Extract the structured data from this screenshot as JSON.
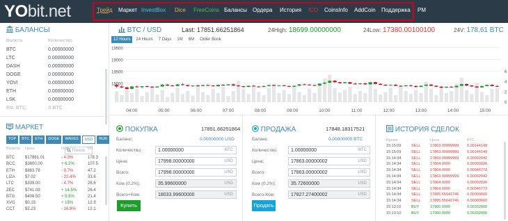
{
  "logo": {
    "main": "YO",
    "rest": "bit.net"
  },
  "nav": [
    {
      "label": "Трейд",
      "color": "#f0ad4e",
      "underline": true
    },
    {
      "label": "Маркет",
      "color": "#ffffff"
    },
    {
      "label": "InvestBox",
      "color": "#5bc0de"
    },
    {
      "label": "Dice",
      "color": "#f0ad4e"
    },
    {
      "label": "FreeCoins",
      "color": "#5cb85c"
    },
    {
      "label": "Балансы",
      "color": "#ffffff"
    },
    {
      "label": "Ордера",
      "color": "#ffffff"
    },
    {
      "label": "История",
      "color": "#ffffff"
    },
    {
      "label": "ICO",
      "color": "#e33333"
    },
    {
      "label": "CoinsInfo",
      "color": "#ffffff"
    },
    {
      "label": "AddCoin",
      "color": "#ffffff"
    },
    {
      "label": "Поддержка",
      "color": "#ffffff"
    },
    {
      "label": "PM",
      "color": "#ffffff"
    }
  ],
  "balances": {
    "title": "БАЛАНСЫ",
    "col_currency": "Валюта",
    "col_amount": "Количество",
    "rows": [
      {
        "cur": "BTC",
        "amt": "0.00000000"
      },
      {
        "cur": "LTC",
        "amt": "0.00000000"
      },
      {
        "cur": "DASH",
        "amt": "0.00000000"
      },
      {
        "cur": "DOGE",
        "amt": "0.00000000"
      },
      {
        "cur": "YOVI",
        "amt": "0.00000000"
      },
      {
        "cur": "ETH",
        "amt": "0.00000000"
      },
      {
        "cur": "LSK",
        "amt": "0.00000000"
      }
    ],
    "est_label": "Est. BTC:",
    "est_value": "X BTC"
  },
  "market": {
    "title": "МАРКЕТ",
    "search_placeholder": "Поиск",
    "tabs": [
      "TOP",
      "BTC",
      "ETH",
      "DOGE",
      "WAVES",
      "USD",
      "RUR"
    ],
    "active_tab": "USD",
    "col_currency": "Валюта",
    "col_price": "Цена",
    "col_change": "Изм.",
    "col_volume": "Об.",
    "rows": [
      {
        "cur": "BTC",
        "price": "$17861.01",
        "chg": "- 4.3%",
        "vol": "178.3",
        "up": false
      },
      {
        "cur": "BCC",
        "price": "$3600.00",
        "chg": "+ 6.2%",
        "vol": "107.5",
        "up": true
      },
      {
        "cur": "ETH",
        "price": "$883.78",
        "chg": "- 0.7%",
        "vol": "47.2",
        "up": false
      },
      {
        "cur": "LIZA",
        "price": "$7.02",
        "chg": "- 22.4%",
        "vol": "33.6",
        "up": false
      },
      {
        "cur": "LTC",
        "price": "$339.00",
        "chg": "- 4.7%",
        "vol": "26.6",
        "up": false
      },
      {
        "cur": "ZEC",
        "price": "$741.09",
        "chg": "+ 14.5%",
        "vol": "26.4",
        "up": true
      },
      {
        "cur": "BTG",
        "price": "$408.50",
        "chg": "+ 5.5%",
        "vol": "21.4",
        "up": true
      },
      {
        "cur": "XVG",
        "price": "$0.15",
        "chg": "+ 15%",
        "vol": "12.9",
        "up": true
      },
      {
        "cur": "CCT",
        "price": "$2.23",
        "chg": "- 16.9%",
        "vol": "12.1",
        "up": false
      }
    ]
  },
  "ticker": {
    "pair_base": "BTC",
    "pair_sep": " / ",
    "pair_quote": "USD",
    "last_label": "Last:",
    "last_value": "17851.66251864",
    "high_label": "24High:",
    "high_value": "18699.00000000",
    "low_label": "24Low:",
    "low_value": "17380.00100100",
    "vol_label": "24V:",
    "vol_value": "178.61 BTC"
  },
  "chart_tabs": [
    "12 Hours",
    "24 Hours",
    "7 Days",
    "1M",
    "6M",
    "Order Book"
  ],
  "chart_active_tab": "12 Hours",
  "chart_data": {
    "type": "candlestick",
    "ylim": [
      17200,
      19600
    ],
    "y_ticks": [
      19500,
      19000,
      18500,
      18000
    ],
    "volume_ylim": [
      0,
      6
    ],
    "volume_ticks": [
      6,
      4,
      2,
      0
    ],
    "x_ticks": [
      "04:00",
      "05:00",
      "06:00",
      "07:00",
      "08:00",
      "09:00",
      "10:00",
      "11:00",
      "12:00",
      "13:00",
      "14:00",
      "15:00"
    ],
    "candles": [
      [
        17920,
        17960,
        17800,
        17860
      ],
      [
        17860,
        17900,
        17780,
        17820
      ],
      [
        17820,
        17850,
        17740,
        17760
      ],
      [
        17760,
        17880,
        17740,
        17860
      ],
      [
        17860,
        17910,
        17800,
        17830
      ],
      [
        17830,
        17880,
        17790,
        17870
      ],
      [
        17870,
        17900,
        17830,
        17850
      ],
      [
        17850,
        17870,
        17800,
        17820
      ],
      [
        17820,
        17880,
        17810,
        17860
      ],
      [
        17860,
        17960,
        17850,
        17940
      ],
      [
        17940,
        17970,
        17880,
        17900
      ],
      [
        17900,
        17930,
        17860,
        17880
      ],
      [
        17880,
        17960,
        17870,
        17950
      ],
      [
        17950,
        18000,
        17900,
        17920
      ],
      [
        17920,
        17940,
        17860,
        17880
      ],
      [
        17880,
        17920,
        17840,
        17900
      ],
      [
        17900,
        17940,
        17870,
        17880
      ],
      [
        17880,
        17930,
        17870,
        17920
      ],
      [
        17920,
        17950,
        17880,
        17900
      ],
      [
        17900,
        17920,
        17850,
        17870
      ],
      [
        17870,
        17940,
        17860,
        17930
      ],
      [
        17930,
        17960,
        17890,
        17910
      ],
      [
        17910,
        17960,
        17900,
        17950
      ],
      [
        17950,
        17980,
        17890,
        17900
      ],
      [
        17900,
        17920,
        17850,
        17870
      ],
      [
        17870,
        17890,
        17820,
        17840
      ],
      [
        17840,
        17900,
        17830,
        17890
      ],
      [
        17890,
        17920,
        17850,
        17860
      ],
      [
        17860,
        17880,
        17820,
        17840
      ],
      [
        17840,
        17900,
        17830,
        17880
      ],
      [
        17880,
        17930,
        17870,
        17920
      ],
      [
        17920,
        17940,
        17880,
        17890
      ],
      [
        17890,
        17920,
        17860,
        17910
      ],
      [
        17910,
        17930,
        17870,
        17880
      ],
      [
        17880,
        17900,
        17840,
        17850
      ],
      [
        17850,
        17900,
        17840,
        17890
      ],
      [
        17890,
        17960,
        17880,
        17950
      ],
      [
        17950,
        17980,
        17920,
        17940
      ],
      [
        17940,
        17960,
        17900,
        17920
      ],
      [
        17920,
        17940,
        17880,
        17900
      ],
      [
        17900,
        17990,
        17890,
        17980
      ],
      [
        17980,
        18040,
        17960,
        18020
      ],
      [
        18020,
        18120,
        18000,
        18100
      ],
      [
        18100,
        18140,
        18020,
        18040
      ],
      [
        18040,
        18060,
        17980,
        18000
      ],
      [
        18000,
        18050,
        17990,
        18040
      ],
      [
        18040,
        18060,
        17960,
        17980
      ],
      [
        17980,
        18020,
        17940,
        17960
      ],
      [
        17960,
        18000,
        17930,
        17990
      ],
      [
        17990,
        18020,
        17940,
        17950
      ],
      [
        17950,
        18050,
        17940,
        18040
      ],
      [
        18040,
        18060,
        17950,
        17970
      ],
      [
        17970,
        18000,
        17920,
        17930
      ],
      [
        17930,
        17960,
        17880,
        17900
      ],
      [
        17900,
        17940,
        17890,
        17930
      ],
      [
        17930,
        17960,
        17880,
        17890
      ],
      [
        17890,
        17910,
        17850,
        17870
      ],
      [
        17870,
        17920,
        17860,
        17910
      ],
      [
        17910,
        17930,
        17860,
        17880
      ],
      [
        17880,
        17900,
        17820,
        17840
      ],
      [
        17840,
        17900,
        17830,
        17890
      ],
      [
        17890,
        17950,
        17880,
        17940
      ],
      [
        17940,
        17960,
        17880,
        17890
      ],
      [
        17890,
        17900,
        17830,
        17850
      ],
      [
        17850,
        17880,
        17790,
        17810
      ],
      [
        17810,
        17860,
        17800,
        17850
      ],
      [
        17850,
        17880,
        17820,
        17830
      ],
      [
        17830,
        17900,
        17820,
        17890
      ],
      [
        17890,
        17970,
        17880,
        17960
      ],
      [
        17960,
        17980,
        17880,
        17900
      ],
      [
        17900,
        17920,
        17840,
        17860
      ],
      [
        17860,
        17880,
        17800,
        17820
      ],
      [
        17820,
        17900,
        17810,
        17880
      ],
      [
        17880,
        17940,
        17870,
        17930
      ],
      [
        17930,
        17960,
        17870,
        17880
      ],
      [
        17880,
        17920,
        17840,
        17860
      ]
    ],
    "volumes": [
      2.1,
      1.4,
      3.0,
      1.8,
      2.6,
      1.2,
      2.0,
      3.2,
      1.5,
      2.4,
      1.0,
      1.8,
      2.8,
      1.6,
      2.2,
      1.3,
      3.4,
      2.0,
      1.4,
      2.6,
      1.8,
      3.0,
      1.2,
      2.2,
      4.2,
      2.6,
      1.6,
      3.0,
      2.0,
      1.4,
      2.8,
      3.6,
      1.8,
      2.4,
      1.6,
      3.2,
      2.0,
      1.4,
      2.6,
      1.8,
      3.4,
      4.6,
      5.4,
      2.8,
      1.9,
      2.4,
      3.0,
      1.6,
      2.2,
      1.8,
      3.6,
      2.6,
      1.5,
      2.0,
      2.8,
      1.4,
      3.2,
      2.2,
      1.6,
      2.4,
      1.8,
      4.0,
      2.6,
      1.4,
      3.0,
      1.8,
      2.2,
      3.6,
      4.8,
      2.4,
      1.6,
      3.8,
      2.0,
      1.4,
      2.6,
      2.8
    ]
  },
  "buy": {
    "title": "ПОКУПКА",
    "header_value": "17851.66251864",
    "balance_label": "Баланс:",
    "balance_value": "0.00000000 USD",
    "qty_label": "Количество:",
    "qty_value": "1.00000000",
    "qty_unit": "BTC",
    "price_label": "Цена:",
    "price_value": "17998.00000000",
    "price_unit": "USD",
    "total_label": "Всего:",
    "total_value": "17998.00000000",
    "total_unit": "USD",
    "fee_label": "Ком (0.2%):",
    "fee_value": "35.99600000",
    "fee_unit": "USD",
    "grand_label": "Всего+Ком:",
    "grand_value": "18033.99600000",
    "grand_unit": "USD",
    "button": "Купить",
    "color": "#1f9c2a"
  },
  "sell": {
    "title": "ПРОДАЖА",
    "header_value": "17848.18317521",
    "balance_label": "Баланс:",
    "balance_value": "0.00000000 BTC",
    "qty_label": "Количество:",
    "qty_value": "1.00000000",
    "qty_unit": "BTC",
    "price_label": "Цена:",
    "price_value": "17863.00000002",
    "price_unit": "USD",
    "total_label": "Всего:",
    "total_value": "17863.00000002",
    "total_unit": "USD",
    "fee_label": "Ком (0.2%):",
    "fee_value": "35.72600000",
    "fee_unit": "USD",
    "grand_label": "Всего-Ком:",
    "grand_value": "17827.27400002",
    "grand_unit": "USD",
    "button": "Продать",
    "color": "#17a2d8"
  },
  "history": {
    "title": "ИСТОРИЯ СДЕЛОК",
    "col_time": "Время",
    "col_price": "Цена",
    "col_btc": "BTC",
    "rows": [
      {
        "time": "15:15:09",
        "type": "SELL",
        "price": "17863.00999999",
        "btc": "0.00144149"
      },
      {
        "time": "15:15:09",
        "type": "SELL",
        "price": "17863.00999999",
        "btc": "0.00144149"
      },
      {
        "time": "15:14:34",
        "type": "SELL",
        "price": "17863.00999999",
        "btc": "0.00002042"
      },
      {
        "time": "15:14:34",
        "type": "SELL",
        "price": "17864.0000",
        "btc": "0.00002826"
      },
      {
        "time": "15:14:34",
        "type": "SELL",
        "price": "17864.0000",
        "btc": "0.00046773"
      },
      {
        "time": "15:14:34",
        "type": "SELL",
        "price": "17863.00999999",
        "btc": "0.00002042"
      },
      {
        "time": "15:14:34",
        "type": "SELL",
        "price": "17864.0000",
        "btc": "0.00002826"
      },
      {
        "time": "15:14:34",
        "type": "SELL",
        "price": "17864.0000",
        "btc": "0.00046773"
      },
      {
        "time": "15:14:34",
        "type": "SELL",
        "price": "17895.55642746",
        "btc": "0.00009660"
      },
      {
        "time": "15:14:34",
        "type": "SELL",
        "price": "17895.55642746",
        "btc": "0.00009660"
      },
      {
        "time": "15:13:10",
        "type": "BUY",
        "price": "17900.0000",
        "btc": "0.00332900"
      },
      {
        "time": "15:13:10",
        "type": "BUY",
        "price": "17900.0000",
        "btc": "0.00332900"
      }
    ]
  }
}
